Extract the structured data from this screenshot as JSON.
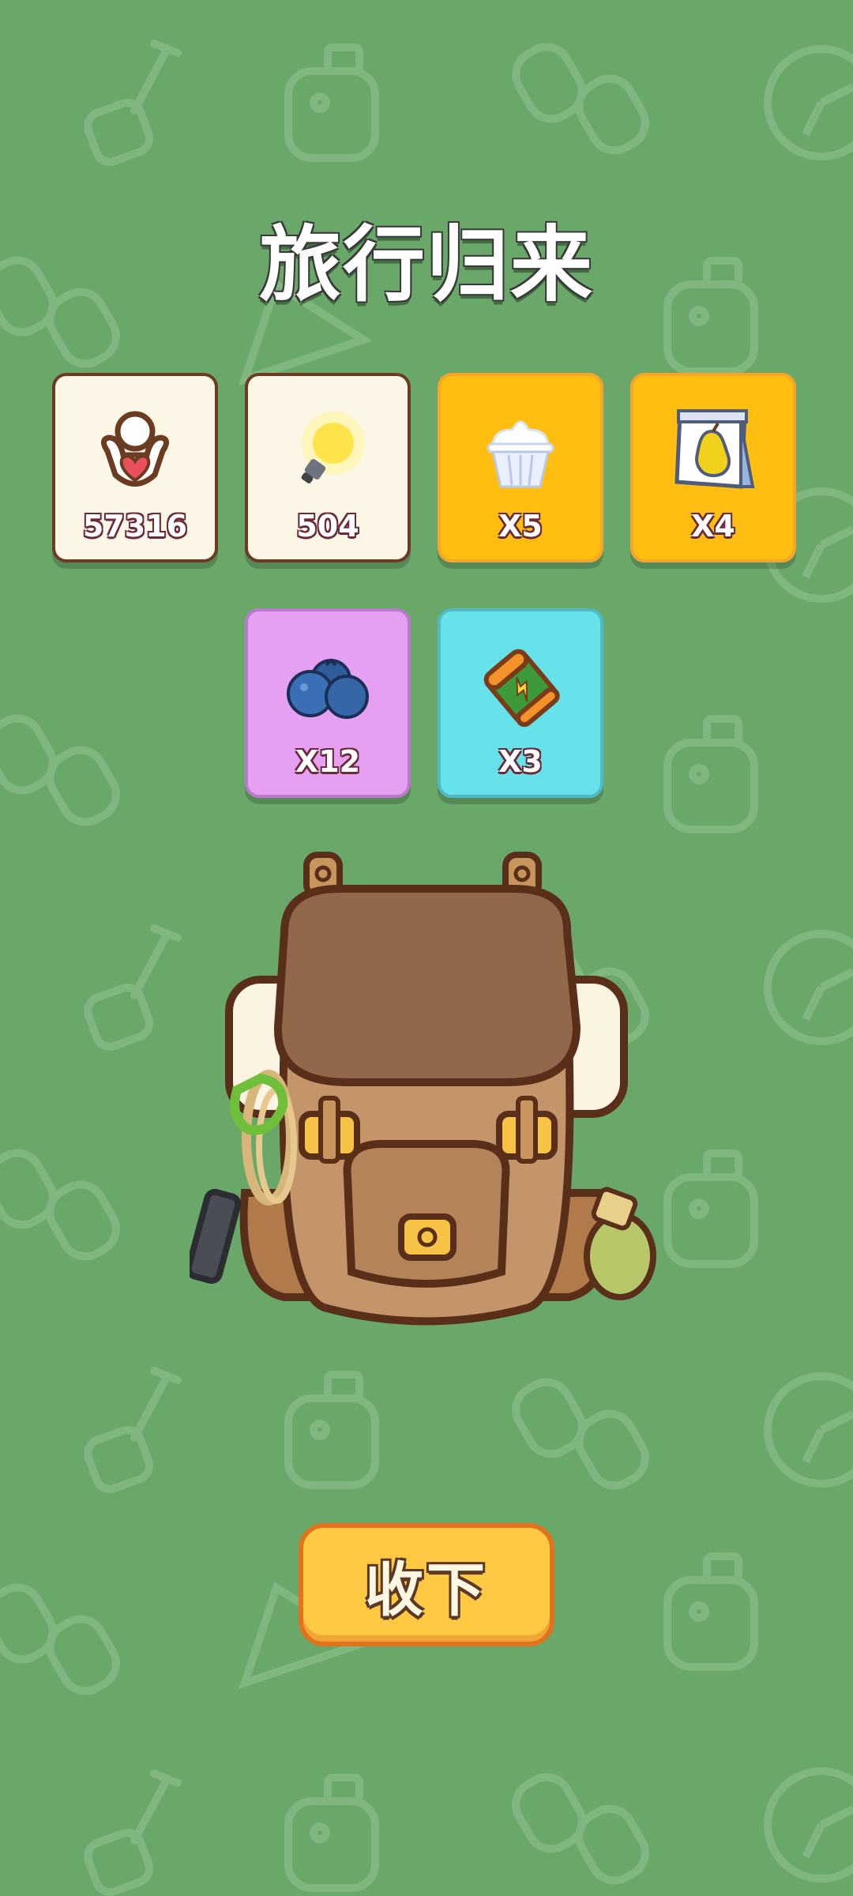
{
  "title": "旅行归来",
  "rewards": [
    {
      "icon": "heart-person-icon",
      "qty": "57316",
      "style": "cream"
    },
    {
      "icon": "lightbulb-icon",
      "qty": "504",
      "style": "cream"
    },
    {
      "icon": "ice-cream-icon",
      "qty": "X5",
      "style": "orange"
    },
    {
      "icon": "pear-seed-packet-icon",
      "qty": "X4",
      "style": "orange"
    },
    {
      "icon": "blueberries-icon",
      "qty": "X12",
      "style": "purple"
    },
    {
      "icon": "battery-icon",
      "qty": "X3",
      "style": "cyan"
    }
  ],
  "accept_button": {
    "label": "收下"
  },
  "colors": {
    "background": "#6aa86a",
    "button": "#ffc943",
    "orange_card": "#ffbe10",
    "purple_card": "#e6a0f2",
    "cyan_card": "#67e2ea"
  }
}
